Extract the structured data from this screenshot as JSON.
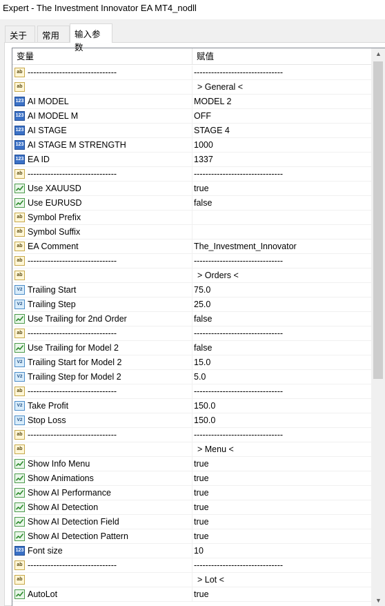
{
  "window": {
    "title": "Expert - The Investment Innovator EA MT4_nodll"
  },
  "tabs": [
    {
      "label": "关于"
    },
    {
      "label": "常用"
    },
    {
      "label": "输入参数"
    }
  ],
  "table": {
    "columns": {
      "variable": "变量",
      "value": "赋值"
    },
    "rows": [
      {
        "type": "ab",
        "name": "-------------------------------",
        "value": "-------------------------------"
      },
      {
        "type": "ab",
        "name": "",
        "value": "> General <"
      },
      {
        "type": "num",
        "name": "AI MODEL",
        "value": "MODEL 2"
      },
      {
        "type": "num",
        "name": "AI MODEL M",
        "value": "OFF"
      },
      {
        "type": "num",
        "name": "AI STAGE",
        "value": "STAGE 4"
      },
      {
        "type": "num",
        "name": "AI STAGE M STRENGTH",
        "value": "1000"
      },
      {
        "type": "num",
        "name": "EA ID",
        "value": "1337"
      },
      {
        "type": "ab",
        "name": "-------------------------------",
        "value": "-------------------------------"
      },
      {
        "type": "bool",
        "name": "Use XAUUSD",
        "value": "true"
      },
      {
        "type": "bool",
        "name": "Use EURUSD",
        "value": "false"
      },
      {
        "type": "ab",
        "name": "Symbol Prefix",
        "value": ""
      },
      {
        "type": "ab",
        "name": "Symbol Suffix",
        "value": ""
      },
      {
        "type": "ab",
        "name": "EA Comment",
        "value": "The_Investment_Innovator"
      },
      {
        "type": "ab",
        "name": "-------------------------------",
        "value": "-------------------------------"
      },
      {
        "type": "ab",
        "name": "",
        "value": "> Orders <"
      },
      {
        "type": "dbl",
        "name": "Trailing Start",
        "value": "75.0"
      },
      {
        "type": "dbl",
        "name": "Trailing Step",
        "value": "25.0"
      },
      {
        "type": "bool",
        "name": "Use Trailing for 2nd Order",
        "value": "false"
      },
      {
        "type": "ab",
        "name": "-------------------------------",
        "value": "-------------------------------"
      },
      {
        "type": "bool",
        "name": "Use Trailing for Model 2",
        "value": "false"
      },
      {
        "type": "dbl",
        "name": "Trailing Start for Model 2",
        "value": "15.0"
      },
      {
        "type": "dbl",
        "name": "Trailing Step for Model 2",
        "value": "5.0"
      },
      {
        "type": "ab",
        "name": "-------------------------------",
        "value": "-------------------------------"
      },
      {
        "type": "dbl",
        "name": "Take Profit",
        "value": "150.0"
      },
      {
        "type": "dbl",
        "name": "Stop Loss",
        "value": "150.0"
      },
      {
        "type": "ab",
        "name": "-------------------------------",
        "value": "-------------------------------"
      },
      {
        "type": "ab",
        "name": "",
        "value": "> Menu <"
      },
      {
        "type": "bool",
        "name": "Show Info Menu",
        "value": "true"
      },
      {
        "type": "bool",
        "name": "Show Animations",
        "value": "true"
      },
      {
        "type": "bool",
        "name": "Show AI Performance",
        "value": "true"
      },
      {
        "type": "bool",
        "name": "Show AI Detection",
        "value": "true"
      },
      {
        "type": "bool",
        "name": "Show AI Detection Field",
        "value": "true"
      },
      {
        "type": "bool",
        "name": "Show AI Detection Pattern",
        "value": "true"
      },
      {
        "type": "num",
        "name": "Font size",
        "value": "10"
      },
      {
        "type": "ab",
        "name": "-------------------------------",
        "value": "-------------------------------"
      },
      {
        "type": "ab",
        "name": "",
        "value": "> Lot <"
      },
      {
        "type": "bool",
        "name": "AutoLot",
        "value": "true"
      }
    ]
  },
  "icons": {
    "ab": {
      "name": "string-type-icon",
      "glyph": "ab"
    },
    "num": {
      "name": "integer-type-icon",
      "glyph": "123"
    },
    "bool": {
      "name": "boolean-type-icon",
      "glyph": ""
    },
    "dbl": {
      "name": "double-type-icon",
      "glyph": "V2"
    }
  },
  "scrollbar": {
    "up_glyph": "▲",
    "down_glyph": "▼"
  }
}
